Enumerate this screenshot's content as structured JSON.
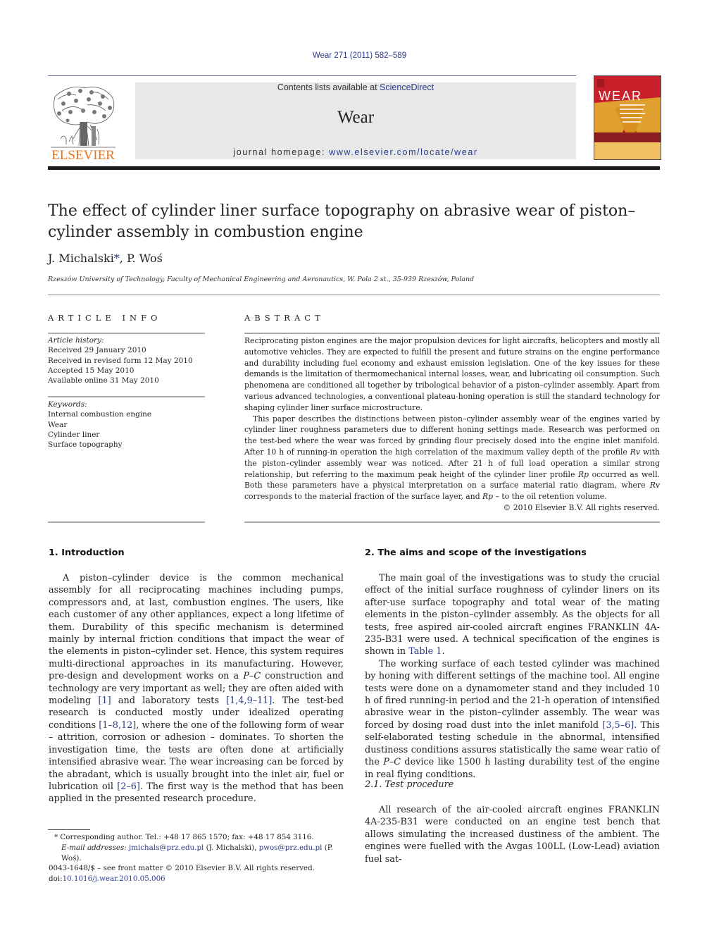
{
  "header": {
    "citation": "Wear 271 (2011) 582–589",
    "contents_prefix": "Contents lists available at ",
    "contents_link": "ScienceDirect",
    "journal_name": "Wear",
    "homepage_prefix": "journal homepage: ",
    "homepage_url": "www.elsevier.com/locate/wear",
    "publisher_logo_text": "ELSEVIER",
    "cover_title": "WEAR"
  },
  "colors": {
    "link": "#2a3a8c",
    "elsevier_orange": "#e8731e",
    "cover_red": "#c8202a",
    "cover_gold": "#e0a030",
    "masthead_bg": "#e8e8e8"
  },
  "article": {
    "title": "The effect of cylinder liner surface topography on abrasive wear of piston–cylinder assembly in combustion engine",
    "authors": [
      {
        "name": "J. Michalski",
        "mark": "*"
      },
      {
        "name": "P. Woś",
        "mark": ""
      }
    ],
    "author_separator": ", ",
    "affiliation": "Rzeszów University of Technology, Faculty of Mechanical Engineering and Aeronautics, W. Pola 2 st., 35-939 Rzeszów, Poland"
  },
  "article_info": {
    "heading": "ARTICLE INFO",
    "history_label": "Article history:",
    "history": [
      "Received 29 January 2010",
      "Received in revised form 12 May 2010",
      "Accepted 15 May 2010",
      "Available online 31 May 2010"
    ],
    "keywords_label": "Keywords:",
    "keywords": [
      "Internal combustion engine",
      "Wear",
      "Cylinder liner",
      "Surface topography"
    ]
  },
  "abstract": {
    "heading": "ABSTRACT",
    "p1": "Reciprocating piston engines are the major propulsion devices for light aircrafts, helicopters and mostly all automotive vehicles. They are expected to fulfill the present and future strains on the engine performance and durability including fuel economy and exhaust emission legislation. One of the key issues for these demands is the limitation of thermomechanical internal losses, wear, and lubricating oil consumption. Such phenomena are conditioned all together by tribological behavior of a piston–cylinder assembly. Apart from various advanced technologies, a conventional plateau-honing operation is still the standard technology for shaping cylinder liner surface microstructure.",
    "p2_a": "This paper describes the distinctions between piston–cylinder assembly wear of the engines varied by cylinder liner roughness parameters due to different honing settings made. Research was performed on the test-bed where the wear was forced by grinding flour precisely dosed into the engine inlet manifold. After 10 h of running-in operation the high correlation of the maximum valley depth of the profile ",
    "rv": "Rv",
    "p2_b": " with the piston–cylinder assembly wear was noticed. After 21 h of full load operation a similar strong relationship, but referring to the maximum peak height of the cylinder liner profile ",
    "rp": "Rp",
    "p2_c": " occurred as well. Both these parameters have a physical interpretation on a surface material ratio diagram, where ",
    "p2_d": " corresponds to the material fraction of the surface layer, and ",
    "p2_e": " – to the oil retention volume.",
    "copyright": "© 2010 Elsevier B.V. All rights reserved."
  },
  "section1": {
    "heading": "1.  Introduction",
    "t1": "A piston–cylinder device is the common mechanical assembly for all reciprocating machines including pumps, compressors and, at last, combustion engines. The users, like each customer of any other appliances, expect a long lifetime of them. Durability of this specific mechanism is determined mainly by internal friction conditions that impact the wear of the elements in piston–cylinder set. Hence, this system requires multi-directional approaches in its manufacturing. However, pre-design and development works on a ",
    "pc": "P–C",
    "t2": " construction and technology are very important as well; they are often aided with modeling ",
    "ref1": "[1]",
    "t3": " and laboratory tests ",
    "ref2": "[1,4,9–11]",
    "t4": ". The test-bed research is conducted mostly under idealized operating conditions ",
    "ref3": "[1–8,12]",
    "t5": ", where the one of the following form of wear – attrition, corrosion or adhesion – dominates. To shorten the investigation time, the tests are often done at artificially intensified abrasive wear. The wear increasing can be forced by the abradant, which is usually brought into the inlet air, fuel or lubrication oil ",
    "ref4": "[2–6]",
    "t6": ". The first way is the method that has been applied in the presented research procedure."
  },
  "section2": {
    "heading": "2.  The aims and scope of the investigations",
    "p1_a": "The main goal of the investigations was to study the crucial effect of the initial surface roughness of cylinder liners on its after-use surface topography and total wear of the mating elements in the piston–cylinder assembly. As the objects for all tests, free aspired air-cooled aircraft engines FRANKLIN 4A-235-B31 were used. A technical specification of the engines is shown in ",
    "table_ref": "Table 1",
    "p1_b": ".",
    "p2_a": "The working surface of each tested cylinder was machined by honing with different settings of the machine tool. All engine tests were done on a dynamometer stand and they included 10 h of fired running-in period and the 21-h operation of intensified abrasive wear in the piston–cylinder assembly. The wear was forced by dosing road dust into the inlet manifold ",
    "ref": "[3,5–6]",
    "p2_b": ". This self-elaborated testing schedule in the abnormal, intensified dustiness conditions assures statistically the same wear ratio of the ",
    "pc": "P–C",
    "p2_c": " device like 1500 h lasting durability test of the engine in real flying conditions.",
    "sub_heading": "2.1.  Test procedure",
    "sub_text": "All research of the air-cooled aircraft engines FRANKLIN 4A-235-B31 were conducted on an engine test bench that allows simulating the increased dustiness of the ambient. The engines were fuelled with the Avgas 100LL (Low-Lead) aviation fuel sat-"
  },
  "footnote": {
    "mark": "*",
    "text": " Corresponding author. Tel.: +48 17 865 1570; fax: +48 17 854 3116.",
    "email_label": "E-mail addresses: ",
    "email1": "jmichals@prz.edu.pl",
    "email1_owner": " (J. Michalski), ",
    "email2": "pwos@prz.edu.pl",
    "email2_owner": " (P. Woś)."
  },
  "front_matter": {
    "issn_line": "0043-1648/$ – see front matter © 2010 Elsevier B.V. All rights reserved.",
    "doi_prefix": "doi:",
    "doi": "10.1016/j.wear.2010.05.006"
  }
}
